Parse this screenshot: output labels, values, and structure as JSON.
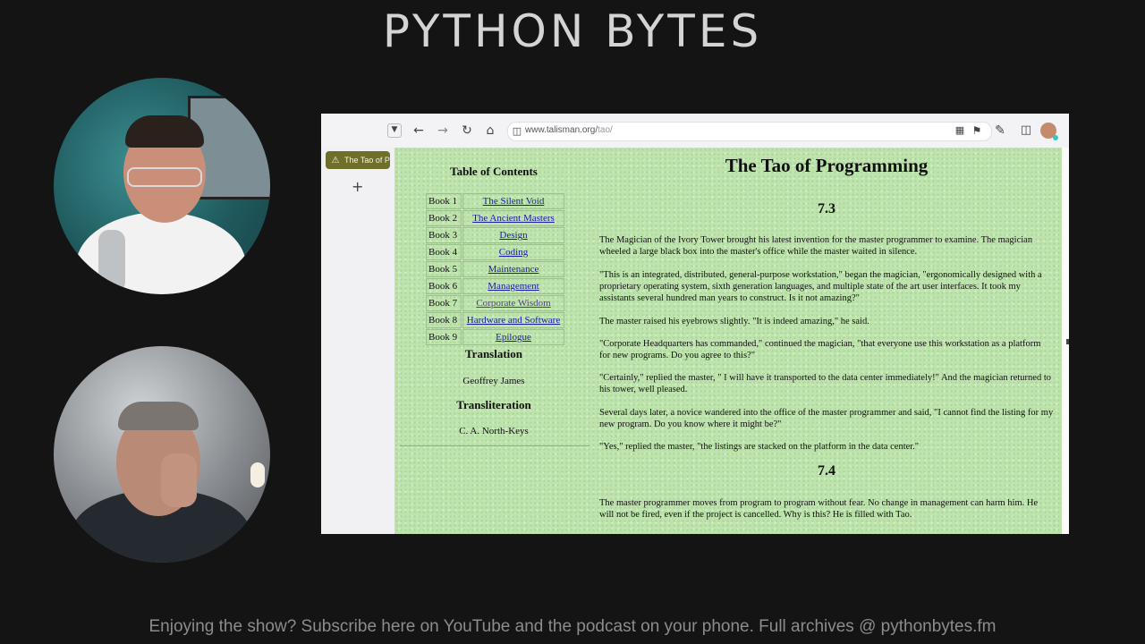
{
  "banner": {
    "title": "PYTHON BYTES"
  },
  "browser": {
    "url": "www.talisman.org/",
    "url_path": "tao/",
    "tab_title": "The Tao of P",
    "new_tab_glyph": "+",
    "icons": [
      "chevron-down-icon",
      "back-icon",
      "forward-icon",
      "reload-icon",
      "home-icon",
      "shield-icon",
      "qr-icon",
      "bookmark-icon",
      "extensions-icon",
      "sidebar-icon",
      "avatar"
    ]
  },
  "toc": {
    "title": "Table of Contents",
    "books": [
      {
        "book": "Book 1",
        "title": "The Silent Void",
        "visited": false
      },
      {
        "book": "Book 2",
        "title": "The Ancient Masters",
        "visited": false
      },
      {
        "book": "Book 3",
        "title": "Design",
        "visited": false
      },
      {
        "book": "Book 4",
        "title": "Coding",
        "visited": false
      },
      {
        "book": "Book 5",
        "title": "Maintenance",
        "visited": false
      },
      {
        "book": "Book 6",
        "title": "Management",
        "visited": false
      },
      {
        "book": "Book 7",
        "title": "Corporate Wisdom",
        "visited": true
      },
      {
        "book": "Book 8",
        "title": "Hardware and Software",
        "visited": false
      },
      {
        "book": "Book 9",
        "title": "Epilogue",
        "visited": false
      }
    ],
    "translation_heading": "Translation",
    "translation_name": "Geoffrey James",
    "transliteration_heading": "Transliteration",
    "transliteration_name": "C. A. North-Keys"
  },
  "article": {
    "title": "The Tao of Programming",
    "section_73": "7.3",
    "paragraphs_73": [
      "The Magician of the Ivory Tower brought his latest invention for the master programmer to examine. The magician wheeled a large black box into the master's office while the master waited in silence.",
      "\"This is an integrated, distributed, general-purpose workstation,\" began the magician, \"ergonomically designed with a proprietary operating system, sixth generation languages, and multiple state of the art user interfaces. It took my assistants several hundred man years to construct. Is it not amazing?\"",
      "The master raised his eyebrows slightly. \"It is indeed amazing,\" he said.",
      "\"Corporate Headquarters has commanded,\" continued the magician, \"that everyone use this workstation as a platform for new programs. Do you agree to this?\"",
      "\"Certainly,\" replied the master, \" I will have it transported to the data center immediately!\" And the magician returned to his tower, well pleased.",
      "Several days later, a novice wandered into the office of the master programmer and said, \"I cannot find the listing for my new program. Do you know where it might be?\"",
      "\"Yes,\" replied the master, \"the listings are stacked on the platform in the data center.\""
    ],
    "section_74": "7.4",
    "paragraphs_74": [
      "The master programmer moves from program to program without fear. No change in management can harm him. He will not be fired, even if the project is cancelled. Why is this? He is filled with Tao."
    ]
  },
  "footer": {
    "text": "Enjoying the show? Subscribe here on YouTube and the podcast on your phone. Full archives @ pythonbytes.fm"
  },
  "colors": {
    "page_bg": "#bfe3ad",
    "tab_pill": "#6e6f2a",
    "link": "#1a1aa6",
    "visited_link": "#5a3b8c"
  }
}
